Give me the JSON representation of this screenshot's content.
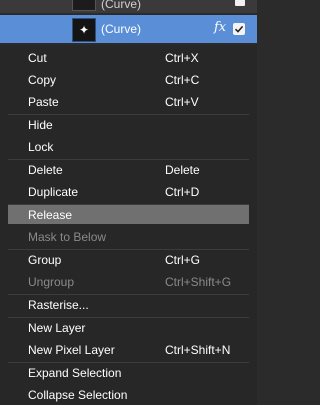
{
  "layers": {
    "top_row": {
      "name": "(Curve)",
      "visible": true
    },
    "selected_row": {
      "name": "(Curve)",
      "fx_label": "fx",
      "visible": true
    }
  },
  "context_menu": {
    "items": [
      {
        "label": "Cut",
        "shortcut": "Ctrl+X"
      },
      {
        "label": "Copy",
        "shortcut": "Ctrl+C"
      },
      {
        "label": "Paste",
        "shortcut": "Ctrl+V"
      },
      {
        "label": "Hide",
        "shortcut": ""
      },
      {
        "label": "Lock",
        "shortcut": ""
      },
      {
        "label": "Delete",
        "shortcut": "Delete"
      },
      {
        "label": "Duplicate",
        "shortcut": "Ctrl+D"
      },
      {
        "label": "Release",
        "shortcut": "",
        "state": "highlighted"
      },
      {
        "label": "Mask to Below",
        "shortcut": "",
        "state": "disabled"
      },
      {
        "label": "Group",
        "shortcut": "Ctrl+G"
      },
      {
        "label": "Ungroup",
        "shortcut": "Ctrl+Shift+G",
        "state": "disabled"
      },
      {
        "label": "Rasterise...",
        "shortcut": ""
      },
      {
        "label": "New Layer",
        "shortcut": ""
      },
      {
        "label": "New Pixel Layer",
        "shortcut": "Ctrl+Shift+N"
      },
      {
        "label": "Expand Selection",
        "shortcut": ""
      },
      {
        "label": "Collapse Selection",
        "shortcut": ""
      }
    ]
  },
  "colors": {
    "selection_blue": "#5a8fd8",
    "menu_background": "#272727",
    "highlight": "#707070",
    "disabled_text": "#8a8a8a"
  }
}
